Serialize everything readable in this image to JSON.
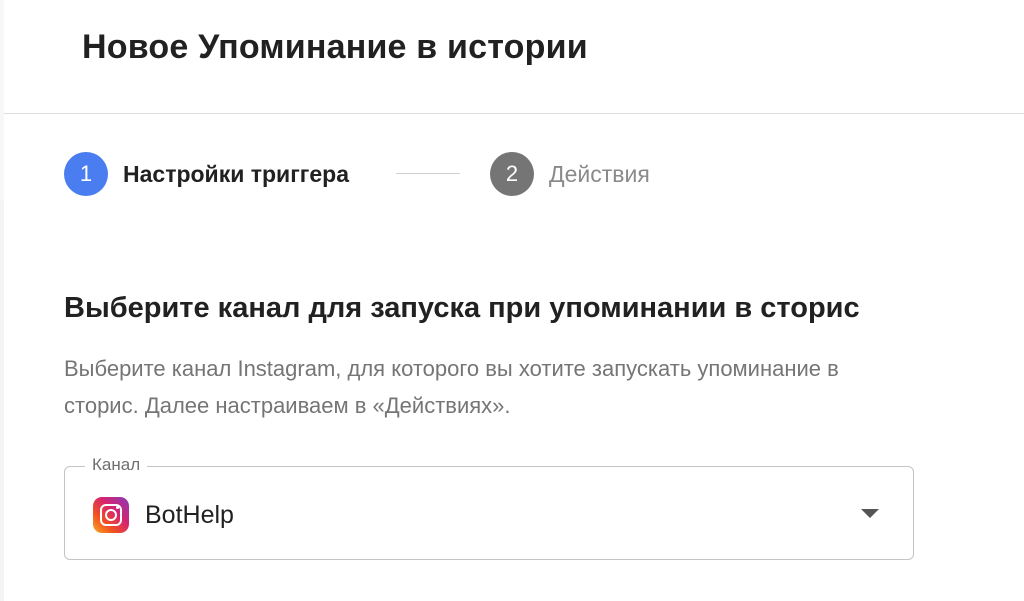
{
  "header": {
    "title": "Новое Упоминание в истории"
  },
  "stepper": {
    "steps": [
      {
        "number": "1",
        "label": "Настройки триггера",
        "state": "active"
      },
      {
        "number": "2",
        "label": "Действия",
        "state": "inactive"
      }
    ]
  },
  "section": {
    "title": "Выберите канал для запуска при упоминании в сторис",
    "description": "Выберите канал Instagram, для которого вы хотите запускать упоминание в сторис. Далее настраиваем в «Действиях»."
  },
  "channel_select": {
    "label": "Канал",
    "value": "BotHelp",
    "icon": "instagram-icon"
  },
  "colors": {
    "accent": "#4a7ef0",
    "inactive_step": "#757575"
  }
}
